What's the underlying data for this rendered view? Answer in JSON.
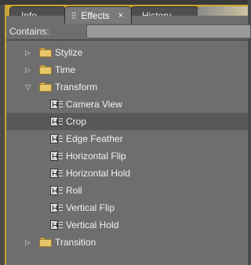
{
  "tabs": {
    "info": "Info",
    "effects": "Effects",
    "effects_close": "×",
    "history": "History"
  },
  "search": {
    "label": "Contains:",
    "value": ""
  },
  "tree": [
    {
      "type": "folder",
      "label": "Stylize",
      "expanded": false
    },
    {
      "type": "folder",
      "label": "Time",
      "expanded": false
    },
    {
      "type": "folder",
      "label": "Transform",
      "expanded": true
    },
    {
      "type": "effect",
      "label": "Camera View"
    },
    {
      "type": "effect",
      "label": "Crop",
      "selected": true
    },
    {
      "type": "effect",
      "label": "Edge Feather"
    },
    {
      "type": "effect",
      "label": "Horizontal Flip"
    },
    {
      "type": "effect",
      "label": "Horizontal Hold"
    },
    {
      "type": "effect",
      "label": "Roll"
    },
    {
      "type": "effect",
      "label": "Vertical Flip"
    },
    {
      "type": "effect",
      "label": "Vertical Hold"
    },
    {
      "type": "folder",
      "label": "Transition",
      "expanded": false
    }
  ],
  "icons": {
    "collapsed": "triangle-right-icon",
    "expanded": "triangle-down-icon",
    "folder": "folder-icon",
    "effect": "video-effect-icon"
  },
  "colors": {
    "panel_frame": "#c8a436",
    "selected_row": "#595959"
  }
}
